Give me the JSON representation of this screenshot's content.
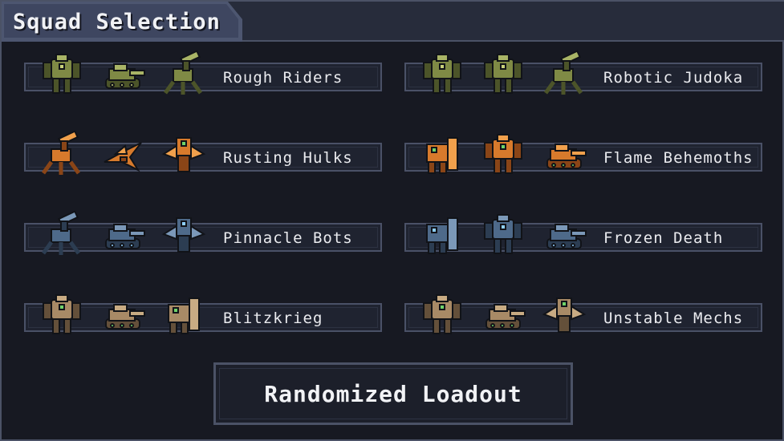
{
  "header": {
    "title": "Squad Selection"
  },
  "colors": {
    "panel_bg": "#171922",
    "frame": "#4b5266",
    "title_tab": "#3e4660",
    "text": "#f1f2f5",
    "olive": "#7f8a45",
    "orange": "#d77a2c",
    "steel_blue": "#4e6a8a",
    "tan": "#a88a66",
    "green_accent": "#6fd36a"
  },
  "squads": [
    {
      "name": "Rough Riders",
      "palette": "olive",
      "mechs": [
        "heavy-mech-icon",
        "tank-mech-icon",
        "artillery-mech-icon"
      ]
    },
    {
      "name": "Robotic Judoka",
      "palette": "olive",
      "mechs": [
        "heavy-mech-icon",
        "walker-mech-icon",
        "missile-mech-icon"
      ]
    },
    {
      "name": "Rusting Hulks",
      "palette": "orange",
      "mechs": [
        "rocket-mech-icon",
        "jet-mech-icon",
        "pulse-mech-icon"
      ]
    },
    {
      "name": "Flame Behemoths",
      "palette": "orange",
      "mechs": [
        "flame-mech-icon",
        "walker-mech-icon",
        "tank-mech-icon"
      ]
    },
    {
      "name": "Pinnacle Bots",
      "palette": "blue",
      "mechs": [
        "artillery-mech-icon",
        "tank-mech-icon",
        "laser-bot-icon"
      ]
    },
    {
      "name": "Frozen Death",
      "palette": "blue",
      "mechs": [
        "shield-mech-icon",
        "ice-mech-icon",
        "tank-mech-icon"
      ]
    },
    {
      "name": "Blitzkrieg",
      "palette": "tan",
      "mechs": [
        "lightning-mech-icon",
        "tank-mech-icon",
        "boulder-mech-icon"
      ]
    },
    {
      "name": "Unstable Mechs",
      "palette": "tan",
      "mechs": [
        "walker-mech-icon",
        "cannon-mech-icon",
        "acid-mech-icon"
      ]
    }
  ],
  "random_button": {
    "label": "Randomized Loadout"
  }
}
